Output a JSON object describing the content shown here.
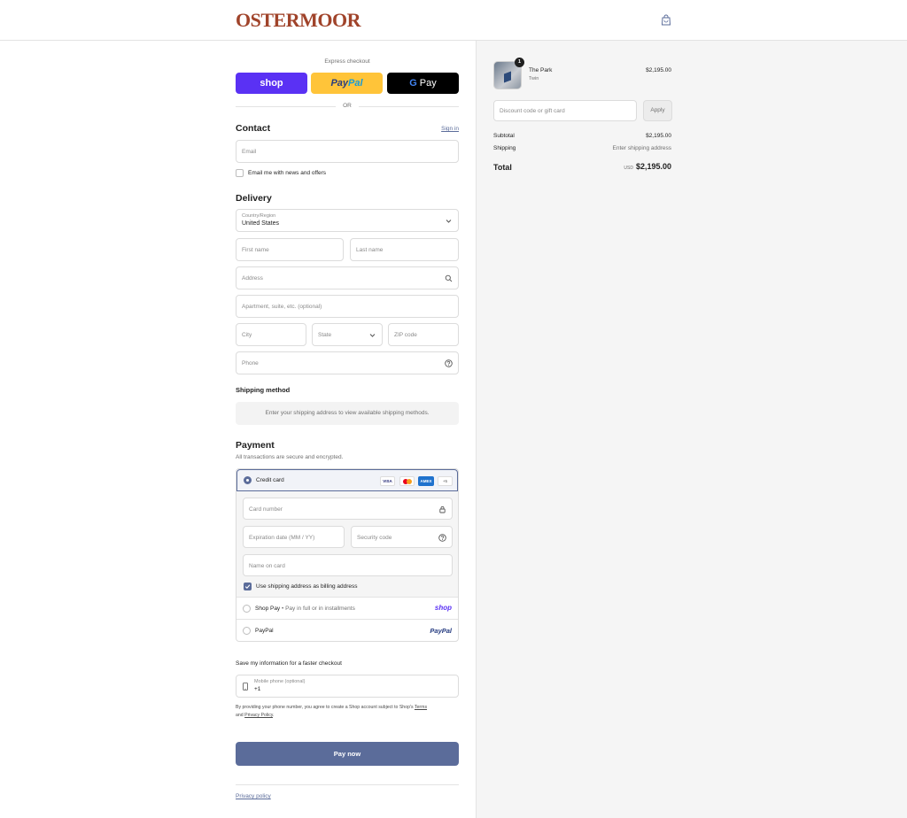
{
  "header": {
    "logo": "OSTERMOOR",
    "bag_icon": "shopping-bag-icon"
  },
  "express": {
    "label": "Express checkout",
    "shop_label": "shop",
    "paypal_label_a": "Pay",
    "paypal_label_b": "Pal",
    "gpay_g": "G",
    "gpay_label": "Pay",
    "or_label": "OR"
  },
  "contact": {
    "title": "Contact",
    "sign_in": "Sign in",
    "email_placeholder": "Email",
    "news_label": "Email me with news and offers"
  },
  "delivery": {
    "title": "Delivery",
    "country_label": "Country/Region",
    "country_value": "United States",
    "first_name": "First name",
    "last_name": "Last name",
    "address": "Address",
    "apartment": "Apartment, suite, etc. (optional)",
    "city": "City",
    "state": "State",
    "zip": "ZIP code",
    "phone": "Phone"
  },
  "shipping": {
    "title": "Shipping method",
    "message": "Enter your shipping address to view available shipping methods."
  },
  "payment": {
    "title": "Payment",
    "subtitle": "All transactions are secure and encrypted.",
    "credit_card_label": "Credit card",
    "brands": [
      "VISA",
      "",
      "AMEX",
      "+5"
    ],
    "card_number": "Card number",
    "expiration": "Expiration date (MM / YY)",
    "security_code": "Security code",
    "name_on_card": "Name on card",
    "billing_same": "Use shipping address as billing address",
    "shop_pay_label": "Shop Pay",
    "shop_pay_sub": "• Pay in full or in installments",
    "shop_pay_logo": "shop",
    "paypal_label": "PayPal",
    "paypal_logo": "PayPal"
  },
  "save_info": {
    "title": "Save my information for a faster checkout",
    "mobile_label": "Mobile phone (optional)",
    "mobile_value": "+1",
    "disclaimer_a": "By providing your phone number, you agree to create a Shop account subject to Shop's",
    "terms": "Terms",
    "disclaimer_and": "and",
    "privacy": "Privacy Policy",
    "period": "."
  },
  "pay_now": "Pay now",
  "footer": {
    "privacy_policy": "Privacy policy"
  },
  "summary": {
    "item_name": "The Park",
    "item_variant": "Twin",
    "item_qty": "1",
    "item_price": "$2,195.00",
    "discount_placeholder": "Discount code or gift card",
    "apply": "Apply",
    "subtotal_label": "Subtotal",
    "subtotal_value": "$2,195.00",
    "shipping_label": "Shipping",
    "shipping_value": "Enter shipping address",
    "total_label": "Total",
    "currency": "USD",
    "total_value": "$2,195.00"
  },
  "colors": {
    "accent": "#5b6c9a",
    "shop": "#5a31f4",
    "paypal": "#ffc439",
    "logo": "#a0432a"
  }
}
